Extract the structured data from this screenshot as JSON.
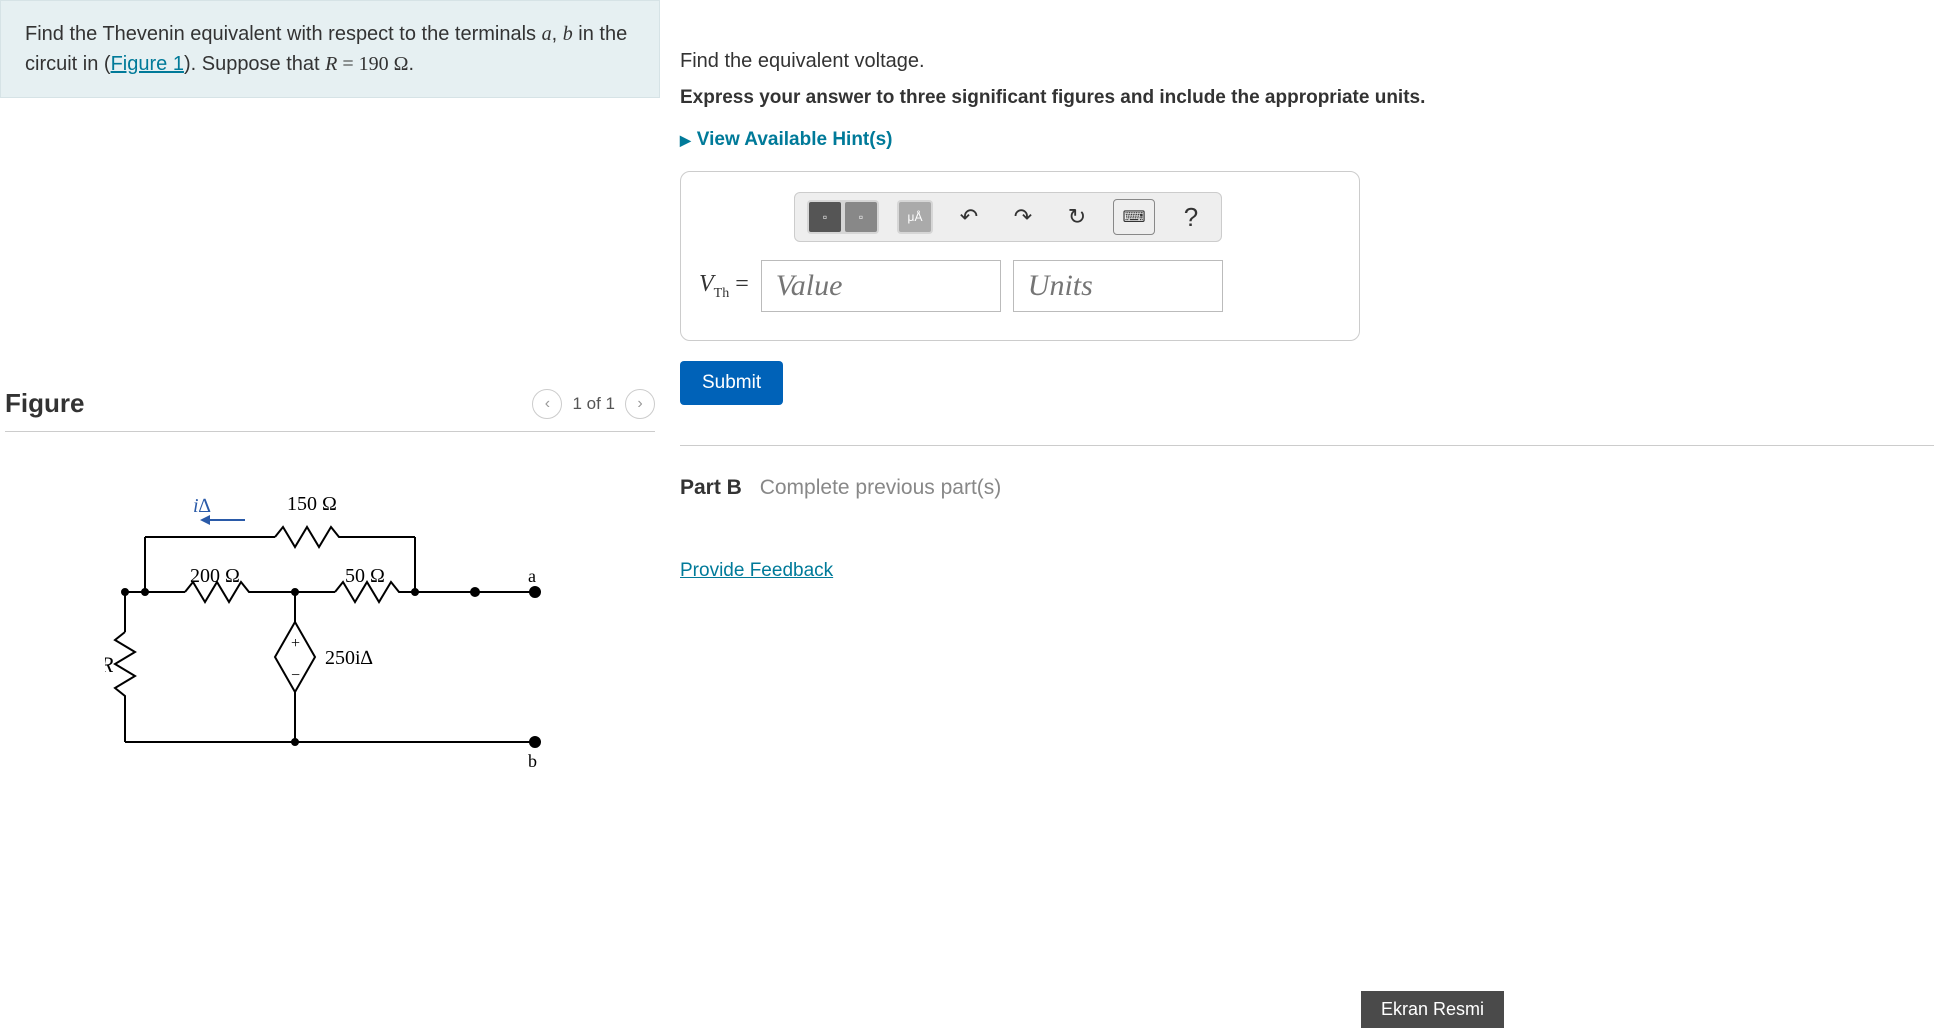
{
  "problem": {
    "text_1": "Find the Thevenin equivalent with respect to the terminals ",
    "var_a": "a",
    "comma": ", ",
    "var_b": "b",
    "text_2": " in the circuit in (",
    "figure_link": "Figure 1",
    "text_3": "). Suppose that ",
    "var_R": "R",
    "eq": " = 190 ",
    "unit": "Ω",
    "period": "."
  },
  "figure": {
    "title": "Figure",
    "counter": "1 of 1",
    "labels": {
      "i_delta": "i∆",
      "r150": "150 Ω",
      "r200": "200 Ω",
      "r50": "50 Ω",
      "dep_source": "250i∆",
      "R": "R",
      "a": "a",
      "b": "b"
    }
  },
  "partA": {
    "instruction": "Find the equivalent voltage.",
    "bold_instruction": "Express your answer to three significant figures and include the appropriate units.",
    "hints": "View Available Hint(s)",
    "label_html": "V",
    "label_sub": "Th",
    "value_placeholder": "Value",
    "units_placeholder": "Units",
    "submit": "Submit"
  },
  "partB": {
    "label": "Part B",
    "text": "Complete previous part(s)"
  },
  "feedback": "Provide Feedback",
  "screenshot_label": "Ekran Resmi",
  "toolbar_icons": {
    "templates": "▫",
    "symbols": "μÅ",
    "undo": "↶",
    "redo": "↷",
    "reset": "↻",
    "keyboard": "⌨",
    "help": "?"
  }
}
